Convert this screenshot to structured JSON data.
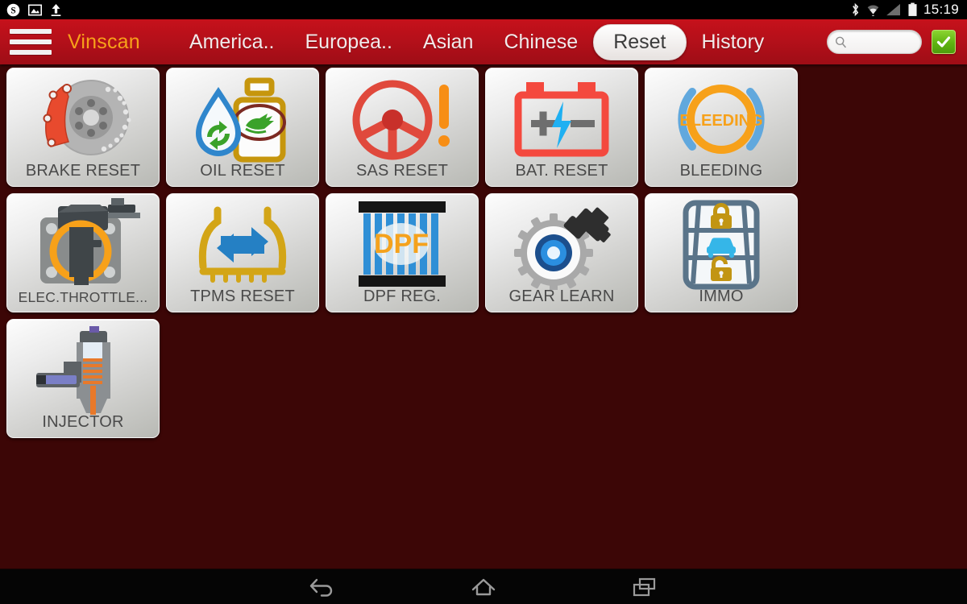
{
  "statusbar": {
    "time": "15:19",
    "left_icons": [
      "skype-icon",
      "screenshot-image-icon",
      "upload-arrow-icon"
    ],
    "right_icons": [
      "bluetooth-icon",
      "wifi-icon",
      "cellular-signal-icon",
      "battery-icon"
    ]
  },
  "header": {
    "brand": "Vinscan",
    "menu_icon": "hamburger-menu-icon",
    "tabs": [
      {
        "label": "America..",
        "active": false
      },
      {
        "label": "Europea..",
        "active": false
      },
      {
        "label": "Asian",
        "active": false
      },
      {
        "label": "Chinese",
        "active": false
      },
      {
        "label": "Reset",
        "active": true
      },
      {
        "label": "History",
        "active": false
      }
    ],
    "search": {
      "value": "",
      "placeholder": "",
      "icon": "search-icon"
    },
    "confirm_button": {
      "icon": "checkmark-icon",
      "color": "#5fb311"
    }
  },
  "grid": {
    "tiles": [
      {
        "id": "brake-reset",
        "label": "BRAKE RESET",
        "icon": "brake-disc-caliper-icon"
      },
      {
        "id": "oil-reset",
        "label": "OIL RESET",
        "icon": "oil-bottle-droplet-icon"
      },
      {
        "id": "sas-reset",
        "label": "SAS RESET",
        "icon": "steering-wheel-warning-icon"
      },
      {
        "id": "bat-reset",
        "label": "BAT. RESET",
        "icon": "car-battery-icon"
      },
      {
        "id": "bleeding",
        "label": "BLEEDING",
        "icon": "brake-bleeding-icon"
      },
      {
        "id": "elec-throttle",
        "label": "ELEC.THROTTLE...",
        "icon": "throttle-body-icon"
      },
      {
        "id": "tpms-reset",
        "label": "TPMS RESET",
        "icon": "tpms-tire-icon"
      },
      {
        "id": "dpf-reg",
        "label": "DPF REG.",
        "icon": "dpf-filter-icon"
      },
      {
        "id": "gear-learn",
        "label": "GEAR LEARN",
        "icon": "gear-wrench-icon"
      },
      {
        "id": "immo",
        "label": "IMMO",
        "icon": "key-fob-icon"
      },
      {
        "id": "injector",
        "label": "INJECTOR",
        "icon": "fuel-injector-icon"
      }
    ]
  },
  "navbar": {
    "buttons": [
      {
        "id": "back",
        "icon": "back-arrow-icon"
      },
      {
        "id": "home",
        "icon": "home-icon"
      },
      {
        "id": "recents",
        "icon": "recent-apps-icon"
      }
    ]
  },
  "colors": {
    "header_red": "#c6111b",
    "brand_orange": "#f7a11a",
    "background_maroon": "#3c0606",
    "accent_green": "#5fb311"
  }
}
